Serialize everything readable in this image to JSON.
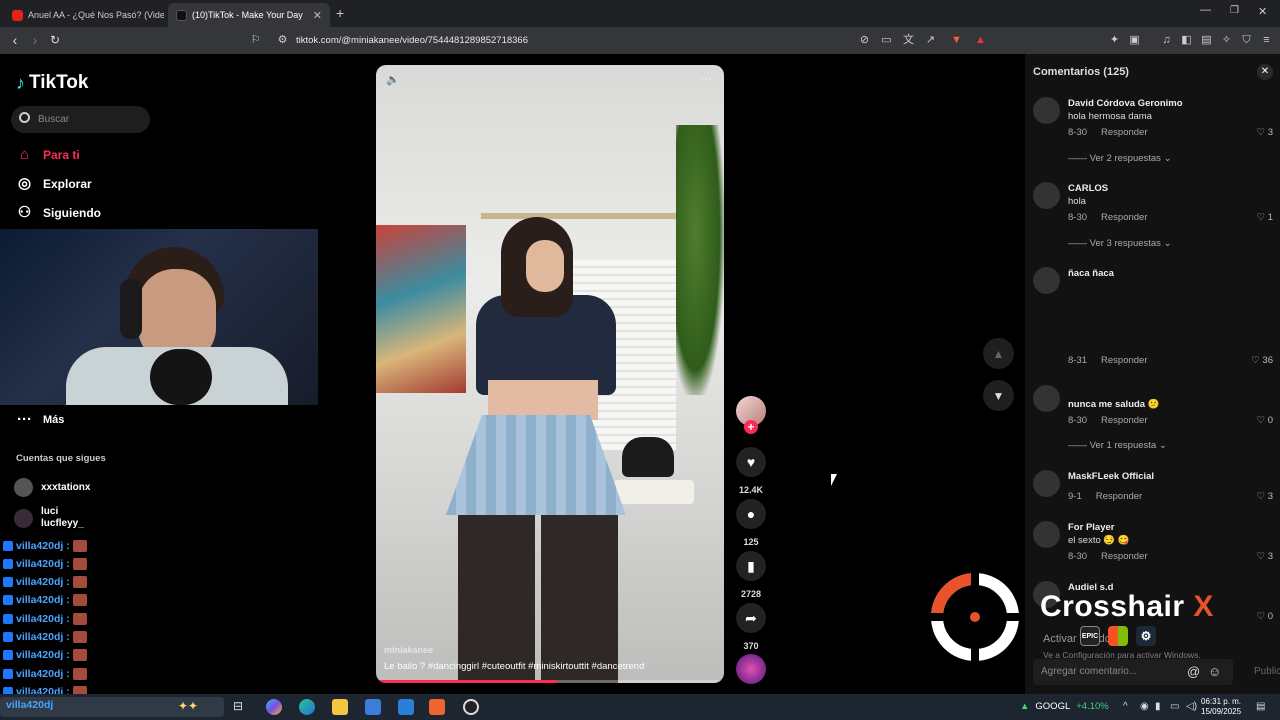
{
  "browser": {
    "tabs": [
      {
        "title": "Anuel AA - ¿Qué Nos Pasó? (Video O",
        "icon": "youtube-icon"
      },
      {
        "title": "(10)TikTok - Make Your Day",
        "icon": "tiktok-icon"
      }
    ],
    "url": "tiktok.com/@miniakanee/video/7544481289852718366"
  },
  "sidebar": {
    "logo": "TikTok",
    "search_placeholder": "Buscar",
    "nav": [
      {
        "label": "Para ti",
        "icon": "home-icon",
        "active": true
      },
      {
        "label": "Explorar",
        "icon": "compass-icon"
      },
      {
        "label": "Siguiendo",
        "icon": "following-icon"
      }
    ],
    "more_label": "Más",
    "following_heading": "Cuentas que sigues",
    "following": [
      {
        "name": "xxxtationx"
      },
      {
        "name": "luci",
        "handle": "lucfleyy_"
      }
    ]
  },
  "stream_chat": [
    "villa420dj :",
    "villa420dj :",
    "villa420dj :",
    "villa420dj :",
    "villa420dj :",
    "villa420dj :",
    "villa420dj :",
    "villa420dj :",
    "villa420dj :",
    "villa420dj"
  ],
  "video": {
    "username": "miniakanee",
    "caption": "Le bailo ? #dancinggirl #cuteoutfit #miniskirtouttit #dancetrend",
    "progress": 0.52
  },
  "actions": {
    "likes": "12.4K",
    "comments": "125",
    "saves": "2728",
    "shares": "370"
  },
  "comments_panel": {
    "title": "Comentarios (125)",
    "items": [
      {
        "name": "David Córdova Geronimo",
        "text": "hola hermosa dama",
        "date": "8-30",
        "reply": "Responder",
        "likes": "3",
        "replies": "Ver 2 respuestas"
      },
      {
        "name": "CARLOS",
        "text": "hola",
        "date": "8-30",
        "reply": "Responder",
        "likes": "1",
        "replies": "Ver 3 respuestas"
      },
      {
        "name": "ñaca ñaca",
        "text": "",
        "date": "8-31",
        "reply": "Responder",
        "likes": "36"
      },
      {
        "name": "",
        "text": "nunca me saluda 😕",
        "date": "8-30",
        "reply": "Responder",
        "likes": "0",
        "replies": "Ver 1 respuesta"
      },
      {
        "name": "MaskFLeek Official",
        "text": "",
        "date": "9-1",
        "reply": "Responder",
        "likes": "3"
      },
      {
        "name": "For Player",
        "text": "el sexto 😏 😋",
        "date": "8-30",
        "reply": "Responder",
        "likes": "3"
      },
      {
        "name": "Audiel s.d",
        "text": "",
        "date": "",
        "reply": "",
        "likes": "0"
      }
    ],
    "input_placeholder": "Agregar comentario...",
    "publish": "Publicar"
  },
  "overlay": {
    "crosshair_name": "Crosshair",
    "crosshair_x": "X",
    "activate_title": "Activar Windows",
    "activate_sub": "Ve a Configuración para activar Windows."
  },
  "taskbar": {
    "ticker_symbol": "GOOGL",
    "ticker_change": "+4.10%",
    "time": "06:31 p. m.",
    "date": "15/09/2025"
  },
  "colors": {
    "accent": "#fe2c55",
    "chat_name": "#4aa3ff",
    "crosshair_orange": "#e8532b",
    "ticker_green": "#3fd27a"
  }
}
